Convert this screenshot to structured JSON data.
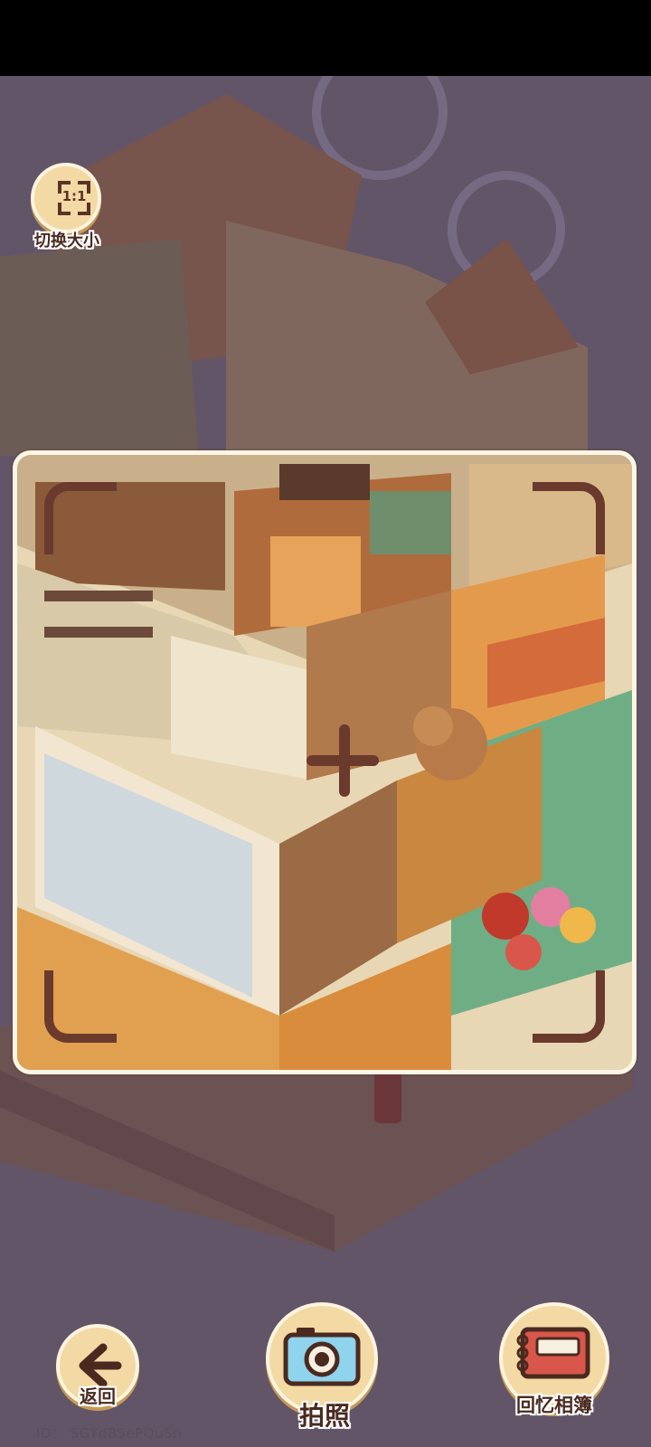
{
  "size_toggle": {
    "ratio": "1:1",
    "label": "切换大小",
    "icon": "aspect-ratio-icon"
  },
  "buttons": {
    "back": {
      "label": "返回",
      "icon": "arrow-left-icon"
    },
    "photo": {
      "label": "拍照",
      "icon": "camera-icon"
    },
    "album": {
      "label": "回忆相簿",
      "icon": "photo-album-icon"
    }
  },
  "player_id": "ID： SGYdBSePQuSn",
  "colors": {
    "button_bg": "#f3d9a4",
    "frame_border": "#fff6e6",
    "marker": "#6a3a2c",
    "scene_bg": "#6d5d6d"
  }
}
